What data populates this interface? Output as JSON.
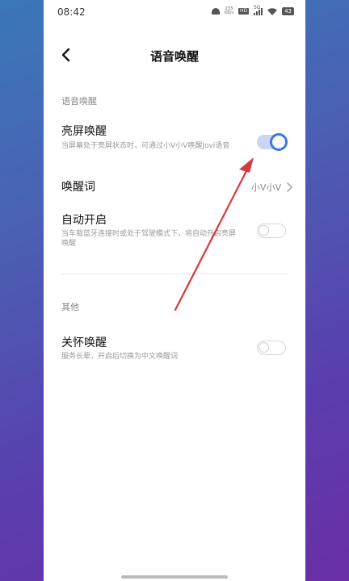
{
  "status_bar": {
    "time": "08:42",
    "net_speed_top": "233",
    "net_speed_bottom": "KB/s",
    "hd_label": "HD",
    "network": "5G",
    "battery": "43"
  },
  "header": {
    "title": "语音唤醒"
  },
  "sections": [
    {
      "label": "语音唤醒"
    },
    {
      "label": "其他"
    }
  ],
  "items": {
    "screen_on_wake": {
      "title": "亮屏唤醒",
      "desc": "当屏幕处于亮屏状态时，可通过小V小V唤醒Jovi语音",
      "enabled": true
    },
    "wake_word": {
      "title": "唤醒词",
      "value": "小V小V"
    },
    "auto_enable": {
      "title": "自动开启",
      "desc": "当车载蓝牙连接时或处于驾驶模式下，将自动开启亮屏唤醒",
      "enabled": false
    },
    "care_wake": {
      "title": "关怀唤醒",
      "desc": "服务长辈，开启后切换为中文唤醒词",
      "enabled": false
    }
  },
  "colors": {
    "accent": "#3e78e0",
    "annotation_arrow": "#d8383f"
  }
}
